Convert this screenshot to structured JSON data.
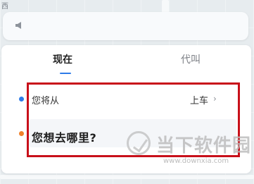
{
  "map": {
    "corner_label": "西"
  },
  "notice": {
    "icon": "speaker-icon"
  },
  "tabs": [
    {
      "label": "现在",
      "active": true
    },
    {
      "label": "代叫",
      "active": false
    }
  ],
  "ride": {
    "from_label": "您将从",
    "pickup_label": "上车",
    "pickup_chevron": "›",
    "destination_prompt": "您想去哪里?"
  },
  "colors": {
    "accent": "#2e7be8",
    "origin_dot": "#2e7be8",
    "destination_dot": "#f0812b",
    "highlight": "#c8101a"
  },
  "watermark": {
    "title": "当下软件园",
    "url": "www.downxia.com"
  }
}
